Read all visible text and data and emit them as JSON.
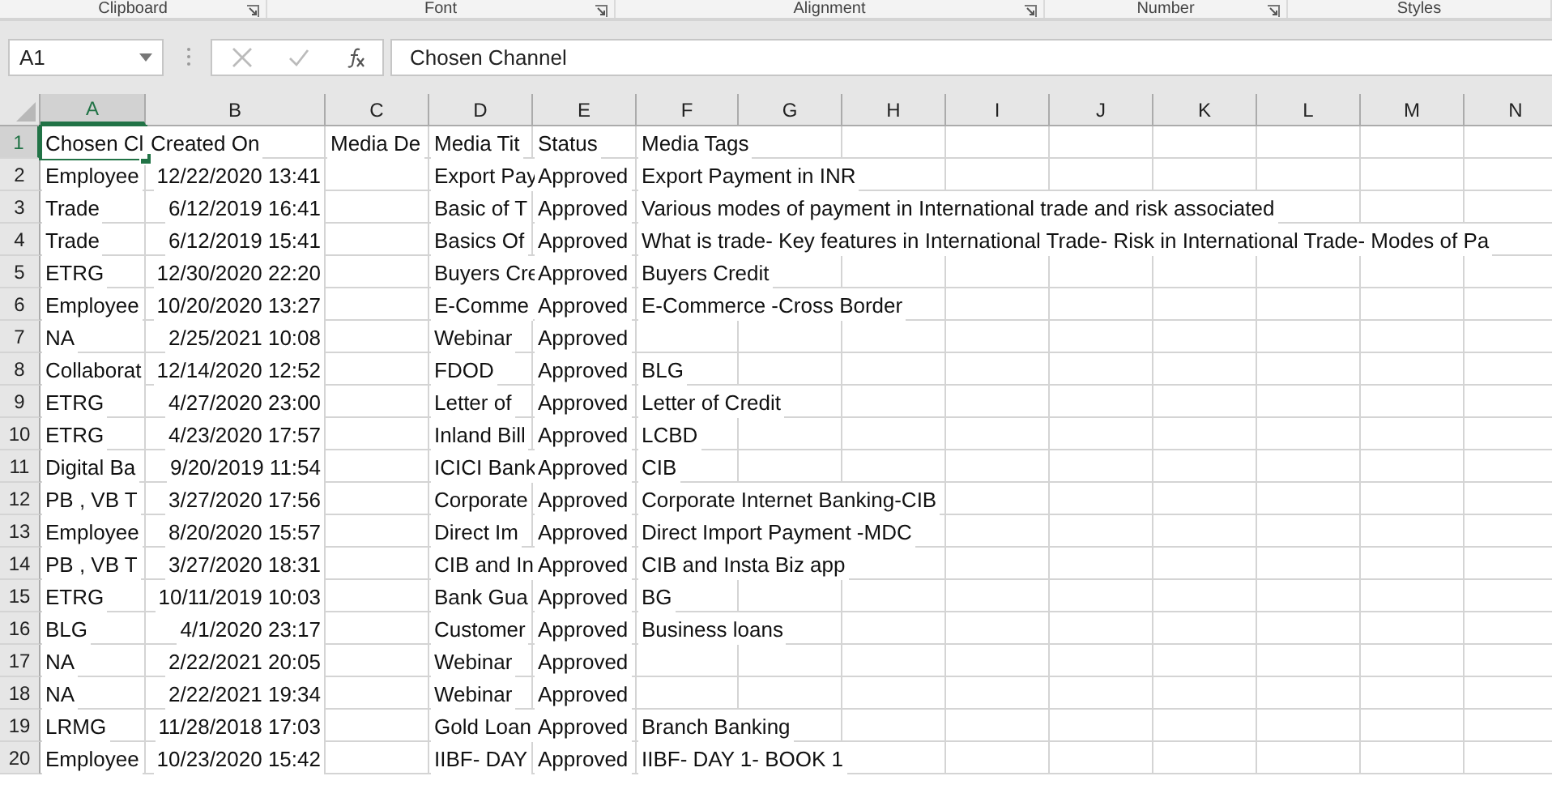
{
  "ribbon_groups": [
    {
      "label": "Clipboard",
      "launcher": true
    },
    {
      "label": "Font",
      "launcher": true
    },
    {
      "label": "Alignment",
      "launcher": true
    },
    {
      "label": "Number",
      "launcher": true
    },
    {
      "label": "Styles",
      "launcher": false
    }
  ],
  "name_box": {
    "value": "A1"
  },
  "formula_bar": {
    "value": "Chosen Channel"
  },
  "columns": [
    {
      "label": "A",
      "selected": true
    },
    {
      "label": "B",
      "selected": false
    },
    {
      "label": "C",
      "selected": false
    },
    {
      "label": "D",
      "selected": false
    },
    {
      "label": "E",
      "selected": false
    },
    {
      "label": "F",
      "selected": false
    },
    {
      "label": "G",
      "selected": false
    },
    {
      "label": "H",
      "selected": false
    },
    {
      "label": "I",
      "selected": false
    },
    {
      "label": "J",
      "selected": false
    },
    {
      "label": "K",
      "selected": false
    },
    {
      "label": "L",
      "selected": false
    },
    {
      "label": "M",
      "selected": false
    },
    {
      "label": "N",
      "selected": false
    }
  ],
  "rows": [
    {
      "number": "1",
      "selected": true,
      "cells": [
        "Chosen Cl",
        "Created On",
        "Media De",
        "Media Tit",
        "Status",
        "Media Tags"
      ]
    },
    {
      "number": "2",
      "selected": false,
      "cells": [
        "Employee",
        "12/22/2020 13:41",
        "",
        "Export Pay",
        "Approved",
        "Export Payment in INR"
      ]
    },
    {
      "number": "3",
      "selected": false,
      "cells": [
        "Trade",
        "6/12/2019 16:41",
        "",
        "Basic of T",
        "Approved",
        "Various modes of payment in International trade and risk associated"
      ]
    },
    {
      "number": "4",
      "selected": false,
      "cells": [
        "Trade",
        "6/12/2019 15:41",
        "",
        "Basics Of",
        "Approved",
        "What is trade- Key features in International Trade- Risk in International Trade- Modes of Pa"
      ]
    },
    {
      "number": "5",
      "selected": false,
      "cells": [
        "ETRG",
        "12/30/2020 22:20",
        "",
        "Buyers Cre",
        "Approved",
        "Buyers Credit"
      ]
    },
    {
      "number": "6",
      "selected": false,
      "cells": [
        "Employee",
        "10/20/2020 13:27",
        "",
        "E-Comme",
        "Approved",
        "E-Commerce -Cross Border"
      ]
    },
    {
      "number": "7",
      "selected": false,
      "cells": [
        "NA",
        "2/25/2021 10:08",
        "",
        "Webinar",
        "Approved",
        ""
      ]
    },
    {
      "number": "8",
      "selected": false,
      "cells": [
        "Collaborat",
        "12/14/2020 12:52",
        "",
        "FDOD",
        "Approved",
        "BLG"
      ]
    },
    {
      "number": "9",
      "selected": false,
      "cells": [
        "ETRG",
        "4/27/2020 23:00",
        "",
        "Letter of",
        "Approved",
        "Letter of Credit"
      ]
    },
    {
      "number": "10",
      "selected": false,
      "cells": [
        "ETRG",
        "4/23/2020 17:57",
        "",
        "Inland Bill",
        "Approved",
        "LCBD"
      ]
    },
    {
      "number": "11",
      "selected": false,
      "cells": [
        "Digital Ba",
        "9/20/2019 11:54",
        "",
        "ICICI Bank",
        "Approved",
        "CIB"
      ]
    },
    {
      "number": "12",
      "selected": false,
      "cells": [
        "PB , VB  T",
        "3/27/2020 17:56",
        "",
        "Corporate",
        "Approved",
        "Corporate Internet Banking-CIB"
      ]
    },
    {
      "number": "13",
      "selected": false,
      "cells": [
        "Employee",
        "8/20/2020 15:57",
        "",
        "Direct Im",
        "Approved",
        "Direct Import Payment -MDC"
      ]
    },
    {
      "number": "14",
      "selected": false,
      "cells": [
        "PB , VB  T",
        "3/27/2020 18:31",
        "",
        "CIB and In",
        "Approved",
        "CIB and Insta Biz app"
      ]
    },
    {
      "number": "15",
      "selected": false,
      "cells": [
        "ETRG",
        "10/11/2019 10:03",
        "",
        "Bank Gua",
        "Approved",
        "BG"
      ]
    },
    {
      "number": "16",
      "selected": false,
      "cells": [
        "BLG",
        "4/1/2020 23:17",
        "",
        "Customer",
        "Approved",
        "Business loans"
      ]
    },
    {
      "number": "17",
      "selected": false,
      "cells": [
        "NA",
        "2/22/2021 20:05",
        "",
        "Webinar",
        "Approved",
        ""
      ]
    },
    {
      "number": "18",
      "selected": false,
      "cells": [
        "NA",
        "2/22/2021 19:34",
        "",
        "Webinar",
        "Approved",
        ""
      ]
    },
    {
      "number": "19",
      "selected": false,
      "cells": [
        "LRMG",
        "11/28/2018 17:03",
        "",
        "Gold Loan",
        "Approved",
        "Branch Banking"
      ]
    },
    {
      "number": "20",
      "selected": false,
      "cells": [
        "Employee",
        "10/23/2020 15:42",
        "",
        "IIBF- DAY",
        "Approved",
        "IIBF- DAY 1- BOOK 1"
      ]
    }
  ]
}
